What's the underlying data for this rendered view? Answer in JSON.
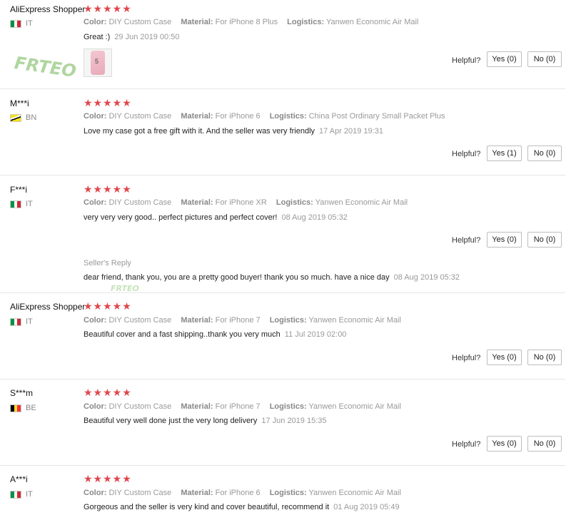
{
  "labels": {
    "color": "Color:",
    "material": "Material:",
    "logistics": "Logistics:",
    "helpful": "Helpful?",
    "sellers_reply": "Seller's Reply"
  },
  "watermark": "FRTEO",
  "reviews": [
    {
      "user": "AliExpress Shopper",
      "country": "IT",
      "stars": "★★★★★",
      "color": "DIY Custom Case",
      "material": "For iPhone 8 Plus",
      "logistics": "Yanwen Economic Air Mail",
      "text": "Great :)",
      "date": "29 Jun 2019 00:50",
      "yes": "Yes (0)",
      "no": "No (0)"
    },
    {
      "user": "M***i",
      "country": "BN",
      "stars": "★★★★★",
      "color": "DIY Custom Case",
      "material": "For iPhone 6",
      "logistics": "China Post Ordinary Small Packet Plus",
      "text": "Love my case got a free gift with it. And the seller was very friendly",
      "date": "17 Apr 2019 19:31",
      "yes": "Yes (1)",
      "no": "No (0)"
    },
    {
      "user": "F***i",
      "country": "IT",
      "stars": "★★★★★",
      "color": "DIY Custom Case",
      "material": "For iPhone XR",
      "logistics": "Yanwen Economic Air Mail",
      "text": "very very very good.. perfect pictures and perfect cover!",
      "date": "08 Aug 2019 05:32",
      "yes": "Yes (0)",
      "no": "No (0)",
      "reply": "dear friend, thank you, you are a pretty good buyer! thank you so much. have a nice day",
      "reply_date": "08 Aug 2019 05:32"
    },
    {
      "user": "AliExpress Shopper",
      "country": "IT",
      "stars": "★★★★★",
      "color": "DIY Custom Case",
      "material": "For iPhone 7",
      "logistics": "Yanwen Economic Air Mail",
      "text": "Beautiful cover and a fast shipping..thank you very much",
      "date": "11 Jul 2019 02:00",
      "yes": "Yes (0)",
      "no": "No (0)"
    },
    {
      "user": "S***m",
      "country": "BE",
      "stars": "★★★★★",
      "color": "DIY Custom Case",
      "material": "For iPhone 7",
      "logistics": "Yanwen Economic Air Mail",
      "text": "Beautiful very well done just the very long delivery",
      "date": "17 Jun 2019 15:35",
      "yes": "Yes (0)",
      "no": "No (0)"
    },
    {
      "user": "A***i",
      "country": "IT",
      "stars": "★★★★★",
      "color": "DIY Custom Case",
      "material": "For iPhone 6",
      "logistics": "Yanwen Economic Air Mail",
      "text": "Gorgeous and the seller is very kind and cover beautiful, recommend it",
      "date": "01 Aug 2019 05:49"
    }
  ],
  "colors": {
    "star": "#e0474c",
    "italy": [
      "#009246",
      "#ffffff",
      "#ce2b37"
    ],
    "belgium": [
      "#000000",
      "#fdda24",
      "#ef3340"
    ],
    "brunei": [
      "#f7e017",
      "#ffffff",
      "#000000"
    ]
  }
}
